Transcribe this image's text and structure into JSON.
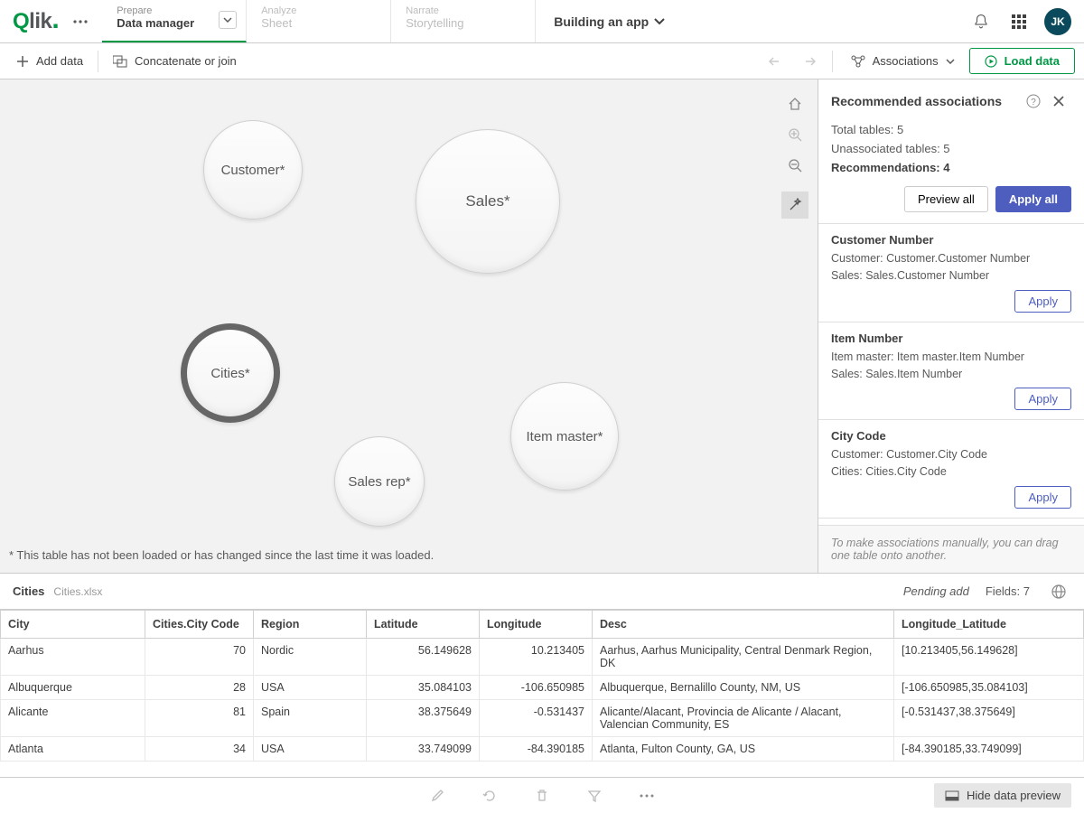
{
  "header": {
    "logo": "Qlik",
    "tabs": [
      {
        "small": "Prepare",
        "big": "Data manager",
        "active": true,
        "hasDropdown": true
      },
      {
        "small": "Analyze",
        "big": "Sheet",
        "disabled": true
      },
      {
        "small": "Narrate",
        "big": "Storytelling",
        "disabled": true
      }
    ],
    "app_title": "Building an app",
    "avatar": "JK"
  },
  "toolbar": {
    "add_data": "Add data",
    "concat": "Concatenate or join",
    "associations": "Associations",
    "load": "Load data"
  },
  "bubbles": {
    "customer": "Customer*",
    "sales": "Sales*",
    "cities": "Cities*",
    "item_master": "Item master*",
    "sales_rep": "Sales rep*",
    "footnote": "* This table has not been loaded or has changed since the last time it was loaded."
  },
  "side": {
    "title": "Recommended associations",
    "total_tables_label": "Total tables: ",
    "total_tables_val": "5",
    "unassoc_label": "Unassociated tables: ",
    "unassoc_val": "5",
    "rec_label": "Recommendations: ",
    "rec_val": "4",
    "preview_all": "Preview all",
    "apply_all": "Apply all",
    "recs": [
      {
        "title": "Customer Number",
        "l1": "Customer: Customer.Customer Number",
        "l2": "Sales: Sales.Customer Number"
      },
      {
        "title": "Item Number",
        "l1": "Item master: Item master.Item Number",
        "l2": "Sales: Sales.Item Number"
      },
      {
        "title": "City Code",
        "l1": "Customer: Customer.City Code",
        "l2": "Cities: Cities.City Code"
      }
    ],
    "apply": "Apply",
    "footer_note": "To make associations manually, you can drag one table onto another."
  },
  "preview": {
    "table_name": "Cities",
    "file_name": "Cities.xlsx",
    "pending": "Pending add",
    "fields_label": "Fields: ",
    "fields_val": "7",
    "columns": [
      "City",
      "Cities.City Code",
      "Region",
      "Latitude",
      "Longitude",
      "Desc",
      "Longitude_Latitude"
    ],
    "rows": [
      {
        "city": "Aarhus",
        "code": "70",
        "region": "Nordic",
        "lat": "56.149628",
        "lon": "10.213405",
        "desc": "Aarhus, Aarhus Municipality, Central Denmark Region, DK",
        "ll": "[10.213405,56.149628]"
      },
      {
        "city": "Albuquerque",
        "code": "28",
        "region": "USA",
        "lat": "35.084103",
        "lon": "-106.650985",
        "desc": "Albuquerque, Bernalillo County, NM, US",
        "ll": "[-106.650985,35.084103]"
      },
      {
        "city": "Alicante",
        "code": "81",
        "region": "Spain",
        "lat": "38.375649",
        "lon": "-0.531437",
        "desc": "Alicante/Alacant, Provincia de Alicante / Alacant, Valencian Community, ES",
        "ll": "[-0.531437,38.375649]"
      },
      {
        "city": "Atlanta",
        "code": "34",
        "region": "USA",
        "lat": "33.749099",
        "lon": "-84.390185",
        "desc": "Atlanta, Fulton County, GA, US",
        "ll": "[-84.390185,33.749099]"
      }
    ]
  },
  "bottom": {
    "hide": "Hide data preview"
  }
}
